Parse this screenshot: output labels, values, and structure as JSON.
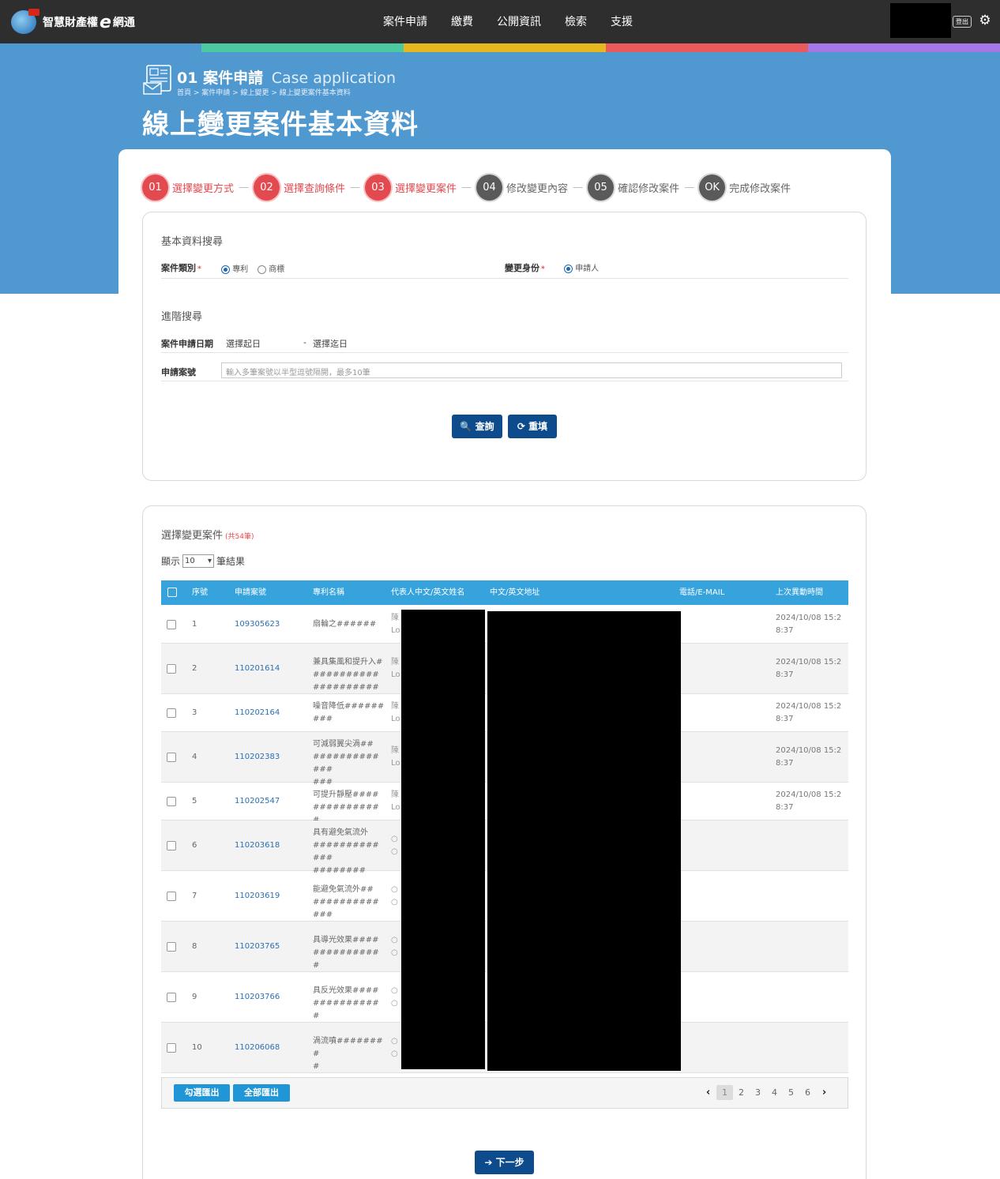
{
  "header": {
    "logo_text": "智慧財產權",
    "logo_e": "e",
    "logo_suffix": "網通",
    "nav": [
      "案件申請",
      "繳費",
      "公開資訊",
      "檢索",
      "支援"
    ],
    "logout_label": "登出"
  },
  "colors": {
    "banner": "#4f98d0",
    "strip": [
      "#4cc9a0",
      "#e6b820",
      "#e85a5c",
      "#a478e6"
    ],
    "step_active": "#e34a4f",
    "table_header": "#36a3dd",
    "primary_button": "#0d4b8c"
  },
  "banner": {
    "section_num": "01",
    "section_title": "案件申請",
    "section_en": "Case application",
    "breadcrumb": "首頁 > 案件申請 > 線上變更 > 線上變更案件基本資料",
    "page_title": "線上變更案件基本資料"
  },
  "steps": [
    {
      "num": "01",
      "label": "選擇變更方式",
      "state": "active"
    },
    {
      "num": "02",
      "label": "選擇查詢條件",
      "state": "active"
    },
    {
      "num": "03",
      "label": "選擇變更案件",
      "state": "active"
    },
    {
      "num": "04",
      "label": "修改變更內容",
      "state": "inactive"
    },
    {
      "num": "05",
      "label": "確認修改案件",
      "state": "inactive"
    },
    {
      "num": "OK",
      "label": "完成修改案件",
      "state": "inactive"
    }
  ],
  "basic_search": {
    "heading": "基本資料搜尋",
    "case_type_label": "案件類別",
    "case_type_options": [
      "專利",
      "商標"
    ],
    "case_type_selected": "專利",
    "identity_label": "變更身份",
    "identity_option": "申請人",
    "required_mark": "*"
  },
  "advanced_search": {
    "heading": "進階搜尋",
    "date_label": "案件申請日期",
    "date_start": "選擇起日",
    "date_sep": "-",
    "date_end": "選擇迄日",
    "case_no_label": "申請案號",
    "case_no_placeholder": "輸入多筆案號以半型逗號隔開，最多10筆",
    "search_button": "查詢",
    "reset_button": "重填"
  },
  "results": {
    "title": "選擇變更案件",
    "count": "(共54筆)",
    "show_prefix": "顯示",
    "page_size": "10",
    "show_suffix": "筆結果",
    "columns": [
      "序號",
      "申請案號",
      "專利名稱",
      "代表人中文/英文姓名",
      "中文/英文地址",
      "電話/E-MAIL",
      "上次異動時間"
    ],
    "rows": [
      {
        "seq": "1",
        "case_no": "109305623",
        "name": "扇輪之######",
        "rep": "陳\nLo",
        "time": "2024/10/08 15:2\n8:37"
      },
      {
        "seq": "2",
        "case_no": "110201614",
        "name": "兼具集風和提升入###########\n##########",
        "rep": "陳\nLo",
        "time": "2024/10/08 15:2\n8:37"
      },
      {
        "seq": "3",
        "case_no": "110202164",
        "name": "噪音降低######\n###",
        "rep": "陳\nLo",
        "time": "2024/10/08 15:2\n8:37"
      },
      {
        "seq": "4",
        "case_no": "110202383",
        "name": "可減弱翼尖渦##\n#############\n###",
        "rep": "陳\nLo",
        "time": "2024/10/08 15:2\n8:37"
      },
      {
        "seq": "5",
        "case_no": "110202547",
        "name": "可提升靜壓####\n###########",
        "rep": "陳\nLo",
        "time": "2024/10/08 15:2\n8:37"
      },
      {
        "seq": "6",
        "case_no": "110203618",
        "name": "具有避免氣流外\n#############\n########",
        "rep": "○\n○",
        "time": ""
      },
      {
        "seq": "7",
        "case_no": "110203619",
        "name": "能避免氣流外##\n#############",
        "rep": "○\n○",
        "time": ""
      },
      {
        "seq": "8",
        "case_no": "110203765",
        "name": "具導光效果####\n###########",
        "rep": "○\n○",
        "time": ""
      },
      {
        "seq": "9",
        "case_no": "110203766",
        "name": "具反光效果####\n###########",
        "rep": "○\n○",
        "time": ""
      },
      {
        "seq": "10",
        "case_no": "110206068",
        "name": "渦流噴########\n#",
        "rep": "○\n○",
        "time": ""
      }
    ],
    "export_selected": "勾選匯出",
    "export_all": "全部匯出",
    "pages": [
      "1",
      "2",
      "3",
      "4",
      "5",
      "6"
    ],
    "current_page": "1"
  },
  "next_button": "下一步"
}
